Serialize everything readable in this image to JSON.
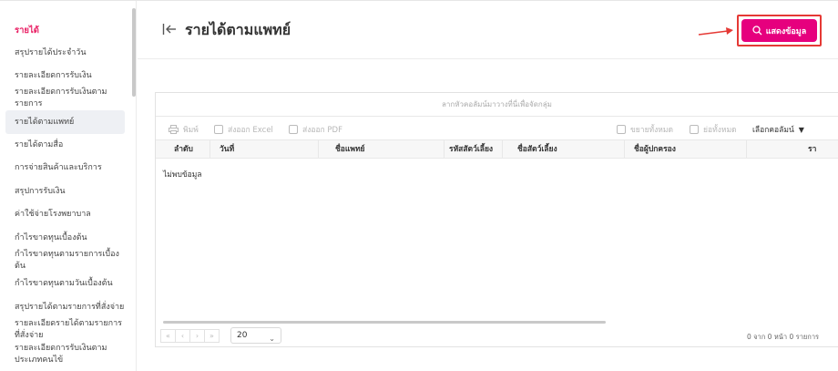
{
  "sidebar": {
    "title": "รายได้",
    "items": [
      {
        "label": "สรุปรายได้ประจำวัน"
      },
      {
        "label": "รายละเอียดการรับเงิน"
      },
      {
        "label": "รายละเอียดการรับเงินตามรายการ"
      },
      {
        "label": "รายได้ตามแพทย์"
      },
      {
        "label": "รายได้ตามสื่อ"
      },
      {
        "label": "การจ่ายสินค้าและบริการ"
      },
      {
        "label": "สรุปการรับเงิน"
      },
      {
        "label": "ค่าใช้จ่ายโรงพยาบาล"
      },
      {
        "label": "กำไรขาดทุนเบื้องต้น"
      },
      {
        "label": "กำไรขาดทุนตามรายการเบื้องต้น"
      },
      {
        "label": "กำไรขาดทุนตามวันเบื้องต้น"
      },
      {
        "label": "สรุปรายได้ตามรายการที่สั่งจ่าย"
      },
      {
        "label": "รายละเอียดรายได้ตามรายการที่สั่งจ่าย"
      },
      {
        "label": "รายละเอียดการรับเงินตามประเภทคนไข้"
      }
    ]
  },
  "header": {
    "title": "รายได้ตามแพทย์",
    "show_button": "แสดงข้อมูล"
  },
  "grid": {
    "group_hint": "ลากหัวคอลัมน์มาวางที่นี่เพื่อจัดกลุ่ม",
    "toolbar": {
      "print": "พิมพ์",
      "export_excel": "ส่งออก Excel",
      "export_pdf": "ส่งออก PDF",
      "expand_all": "ขยายทั้งหมด",
      "collapse_all": "ย่อทั้งหมด",
      "choose_columns": "เลือกคอลัมน์"
    },
    "columns": [
      "ลำดับ",
      "วันที่",
      "ชื่อแพทย์",
      "รหัสสัตว์เลี้ยง",
      "ชื่อสัตว์เลี้ยง",
      "ชื่อผู้ปกครอง",
      "รา"
    ],
    "empty_text": "ไม่พบข้อมูล",
    "pager": {
      "buttons": [
        "«",
        "‹",
        "›",
        "»"
      ],
      "page_size": "20",
      "info": "0 จาก 0 หน้า 0 รายการ"
    }
  },
  "colors": {
    "accent": "#e6007e",
    "sidebar_title": "#e91e63",
    "highlight_border": "#e53935"
  }
}
